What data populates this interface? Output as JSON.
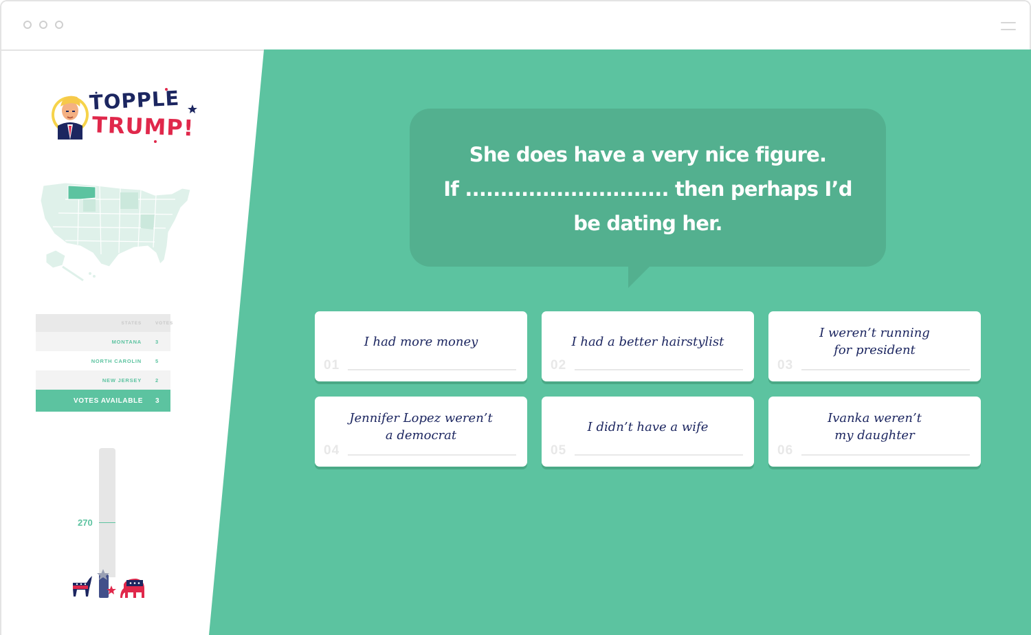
{
  "colors": {
    "accent": "#5cc3a0",
    "bubble": "#53b08f",
    "navy": "#1c2660",
    "red": "#e0284b"
  },
  "logo": {
    "line1": "TOPPLE",
    "line2": "TRUMP!"
  },
  "map": {
    "highlighted_state": "Montana"
  },
  "vote_table": {
    "headers": {
      "states": "STATES",
      "votes": "VOTES"
    },
    "rows": [
      {
        "state": "MONTANA",
        "votes": "3"
      },
      {
        "state": "NORTH CAROLIN",
        "votes": "5"
      },
      {
        "state": "NEW JERSEY",
        "votes": "2"
      }
    ],
    "total": {
      "label": "VOTES AVAILABLE",
      "value": "3"
    }
  },
  "meter": {
    "threshold_label": "270"
  },
  "question": {
    "line1": "She does have a very nice figure.",
    "line2": "If ............................. then perhaps I’d",
    "line3": "be dating her."
  },
  "answers": [
    {
      "num": "01",
      "text": "I had more money"
    },
    {
      "num": "02",
      "text": "I had a better hairstylist"
    },
    {
      "num": "03",
      "text": "I weren’t running\nfor president"
    },
    {
      "num": "04",
      "text": "Jennifer Lopez weren’t\na democrat"
    },
    {
      "num": "05",
      "text": "I didn’t have a wife"
    },
    {
      "num": "06",
      "text": "Ivanka weren’t\nmy daughter"
    }
  ]
}
